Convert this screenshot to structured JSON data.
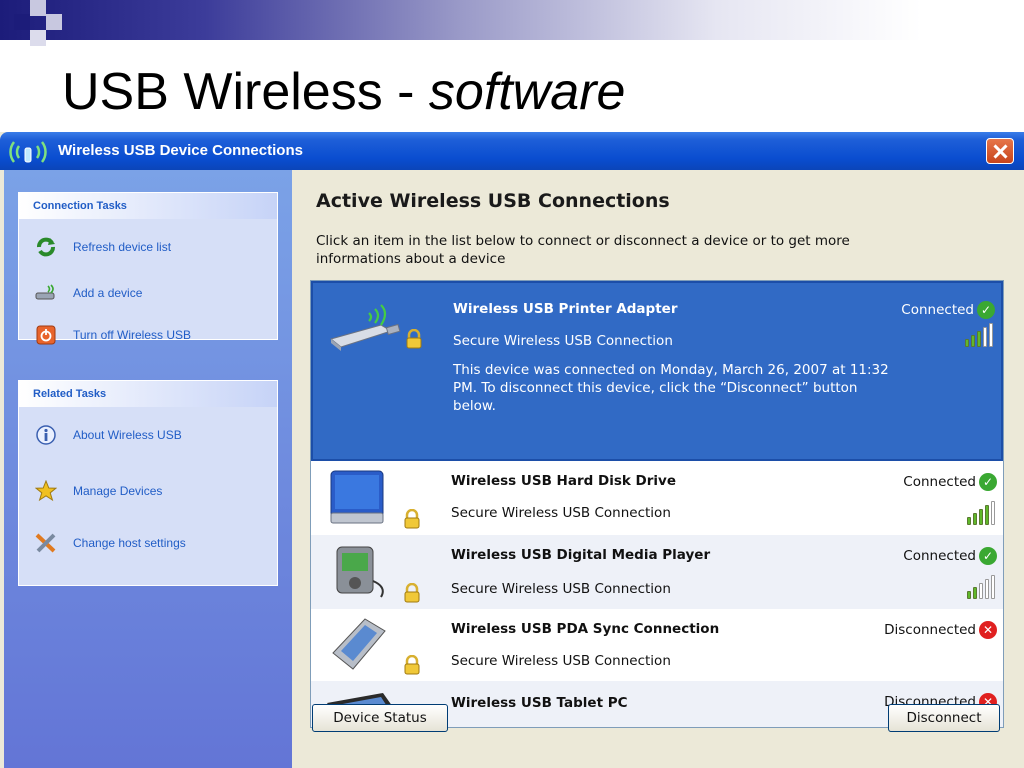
{
  "slide": {
    "title_main": "USB Wireless - ",
    "title_italic": "software"
  },
  "window": {
    "title": "Wireless USB Device Connections",
    "colors": {
      "titlebar": "#0a4dd0",
      "selection": "#316ac5",
      "task_link": "#215dc6"
    }
  },
  "sidebar": {
    "connection_tasks": {
      "header": "Connection Tasks",
      "items": [
        {
          "label": "Refresh device list",
          "icon": "refresh-icon"
        },
        {
          "label": "Add a device",
          "icon": "add-device-icon"
        },
        {
          "label": "Turn off Wireless USB",
          "icon": "power-icon"
        }
      ]
    },
    "related_tasks": {
      "header": "Related Tasks",
      "items": [
        {
          "label": "About Wireless USB",
          "icon": "info-icon"
        },
        {
          "label": "Manage Devices",
          "icon": "star-icon"
        },
        {
          "label": "Change host settings",
          "icon": "tools-icon"
        }
      ]
    }
  },
  "main": {
    "heading": "Active Wireless USB Connections",
    "description": "Click an item in the list below to connect or disconnect a device or to get more informations about a device",
    "devices": [
      {
        "name": "Wireless USB Printer Adapter",
        "subtitle": "Secure Wireless USB Connection",
        "status": "Connected",
        "signal_bars": 3,
        "detail": "This device was connected on Monday, March 26, 2007 at 11:32 PM. To disconnect this device, click the “Disconnect” button below."
      },
      {
        "name": "Wireless USB Hard Disk Drive",
        "subtitle": "Secure Wireless USB Connection",
        "status": "Connected",
        "signal_bars": 4
      },
      {
        "name": "Wireless USB Digital Media Player",
        "subtitle": "Secure Wireless USB Connection",
        "status": "Connected",
        "signal_bars": 2
      },
      {
        "name": "Wireless USB PDA Sync Connection",
        "subtitle": "Secure Wireless USB Connection",
        "status": "Disconnected"
      },
      {
        "name": "Wireless USB Tablet PC",
        "status": "Disconnected"
      }
    ],
    "buttons": {
      "device_status": "Device Status",
      "disconnect": "Disconnect"
    }
  }
}
